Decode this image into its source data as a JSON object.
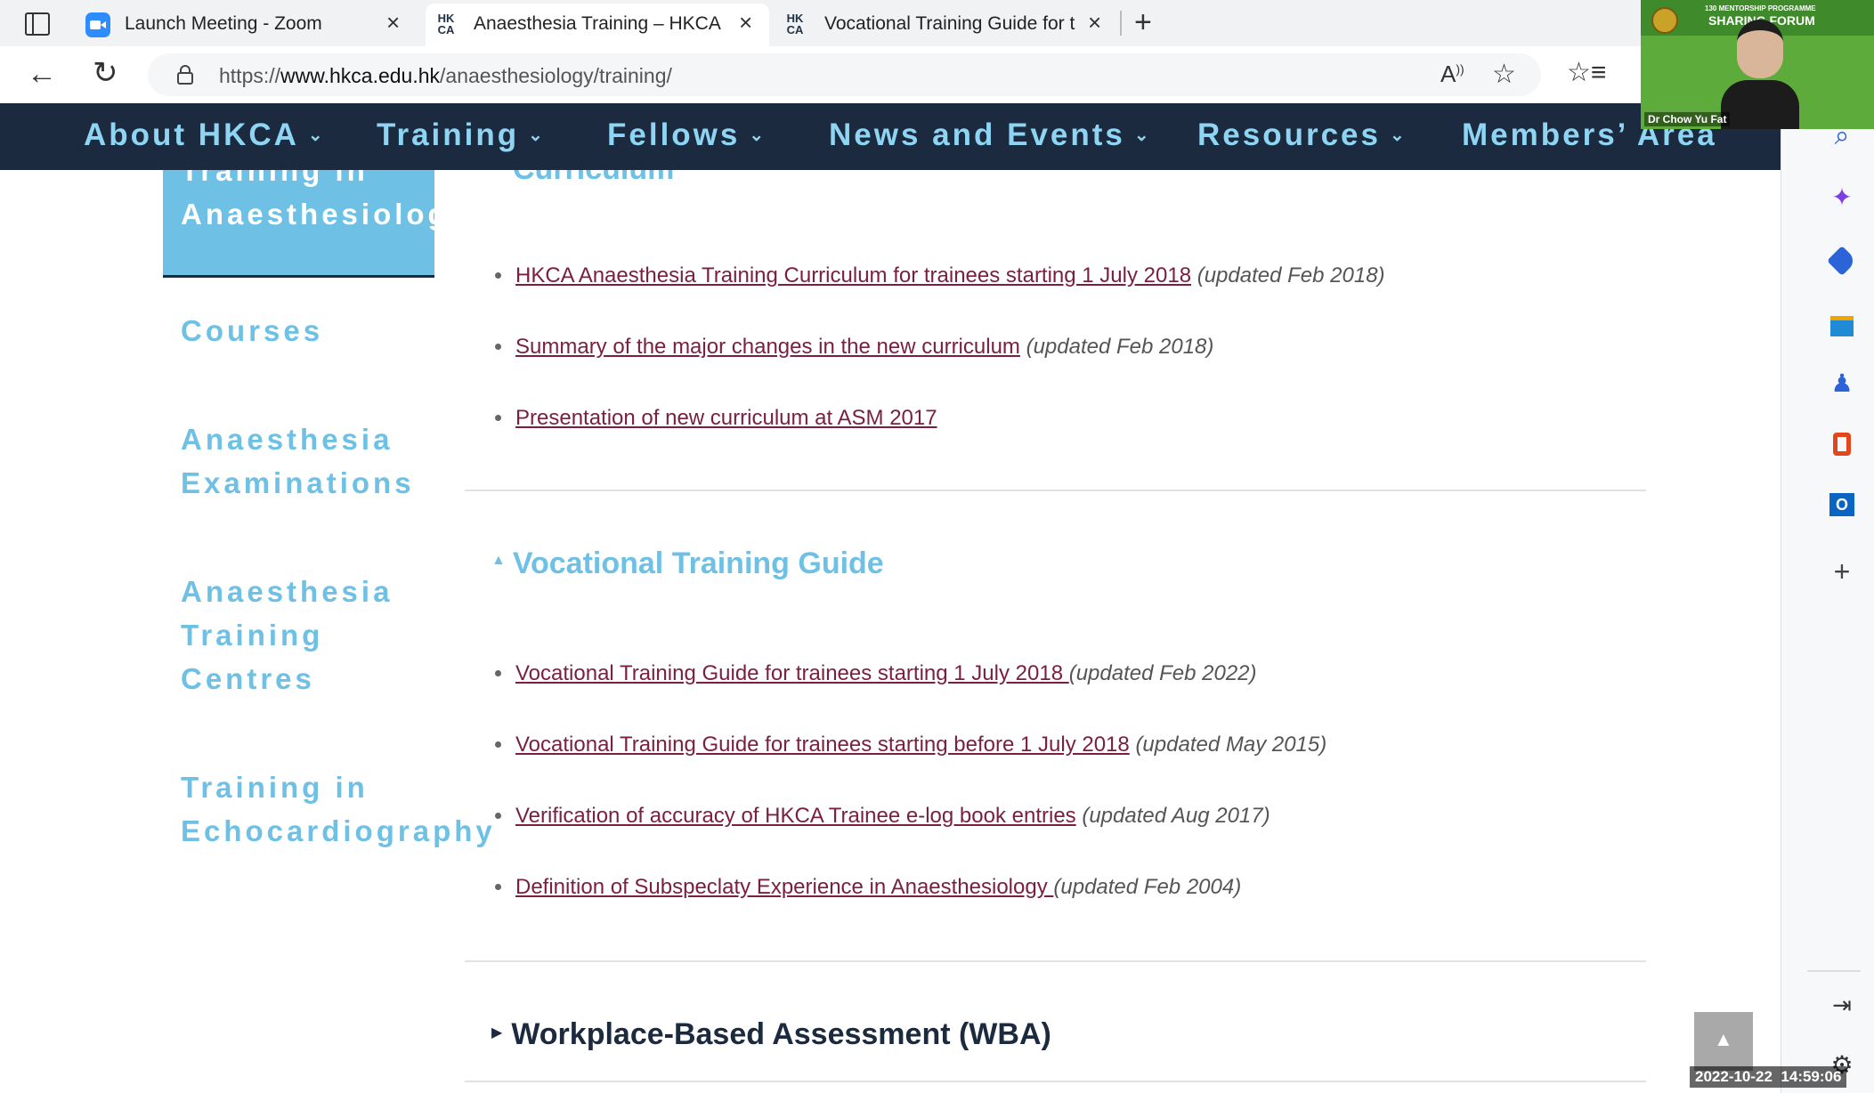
{
  "browser": {
    "tabs": [
      {
        "title": "Launch Meeting - Zoom",
        "active": false
      },
      {
        "title": "Anaesthesia Training – HKCA",
        "active": true
      },
      {
        "title": "Vocational Training Guide for tra",
        "active": false
      }
    ],
    "url_prefix": "https://",
    "url_domain": "www.hkca.edu.hk",
    "url_path": "/anaesthesiology/training/",
    "tab_icon_text": "HK\nCA"
  },
  "nav": {
    "items": [
      "About HKCA",
      "Training",
      "Fellows",
      "News and Events",
      "Resources",
      "Members’ Area"
    ]
  },
  "sidebar": {
    "active_item": "Training in\nAnaesthesiology",
    "items": [
      "Courses",
      "Anaesthesia\nExaminations",
      "Anaesthesia\nTraining\nCentres",
      "Training in\nEchocardiography"
    ]
  },
  "content": {
    "cut_heading": "Curriculum",
    "curriculum_links": [
      {
        "label": "HKCA Anaesthesia Training Curriculum for trainees starting 1 July 2018",
        "updated": "(updated Feb 2018)"
      },
      {
        "label": "Summary of the major changes in the new curriculum",
        "updated": "(updated Feb 2018)"
      },
      {
        "label": "Presentation of new curriculum at ASM 2017",
        "updated": ""
      }
    ],
    "vtg_heading": "Vocational Training Guide",
    "vtg_links": [
      {
        "label": "Vocational Training Guide for trainees starting 1 July 2018 ",
        "updated": "(updated Feb 2022)"
      },
      {
        "label": "Vocational Training Guide for trainees starting before 1 July 2018",
        "updated": "(updated May 2015)"
      },
      {
        "label": "Verification of accuracy of HKCA Trainee e-log book entries",
        "updated": "(updated Aug 2017)"
      },
      {
        "label": "Definition of Subspeclaty Experience in Anaesthesiology ",
        "updated": "(updated Feb 2004)"
      }
    ],
    "wba_heading": "Workplace-Based Assessment (WBA)"
  },
  "video_overlay": {
    "banner_line1": "130 MENTORSHIP PROGRAMME",
    "banner_line2": "SHARING FORUM",
    "name": "Dr Chow Yu Fat"
  },
  "timestamp": "2022-10-22  14:59:06",
  "colors": {
    "nav_bg": "#1c2a3f",
    "nav_text": "#8ed4f3",
    "accent": "#6ec1e4",
    "link": "#7a1f3d"
  }
}
